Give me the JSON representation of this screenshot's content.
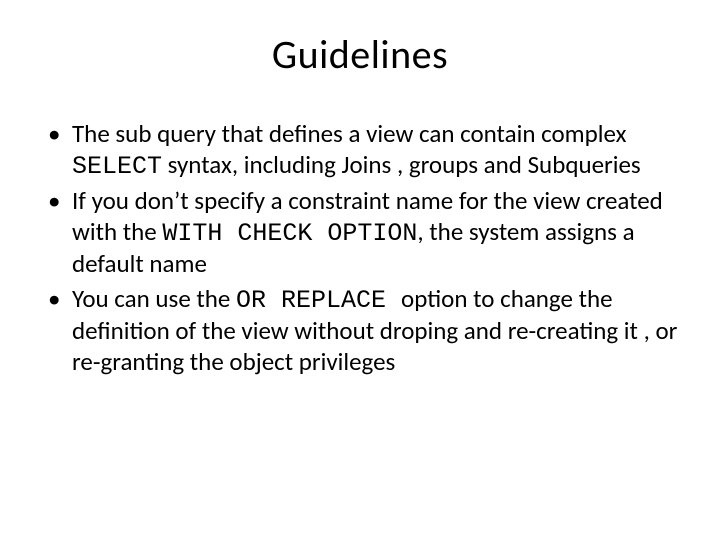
{
  "title": "Guidelines",
  "bullets": [
    {
      "pre": "The sub query that defines a view can contain complex ",
      "code": "SELECT",
      "post": " syntax, including Joins , groups and Subqueries"
    },
    {
      "pre": "If you don’t specify a constraint name for the view created with the ",
      "code": "WITH CHECK OPTION",
      "post": ", the system assigns a default name"
    },
    {
      "pre": "You can use the ",
      "code": "OR REPLACE ",
      "post": " option to change the definition of the view without droping and re-creating it , or re-granting the object privileges"
    }
  ]
}
